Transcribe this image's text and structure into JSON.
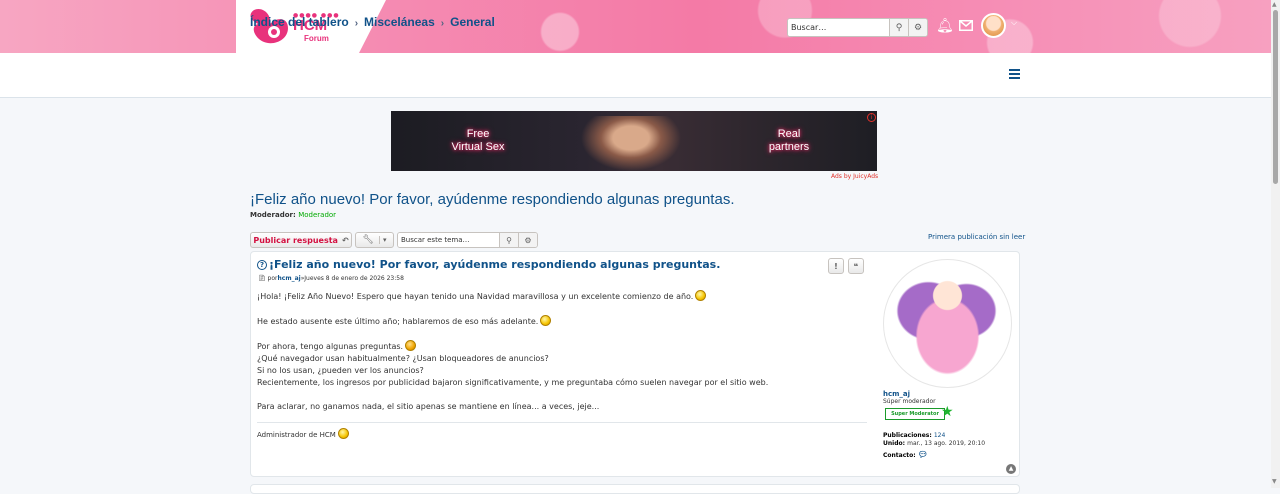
{
  "header": {
    "logo_text": "HCM",
    "logo_sub": "Forum",
    "search_placeholder": "Buscar…",
    "icons": [
      "search-icon",
      "gear-icon",
      "bell-icon",
      "envelope-icon",
      "avatar",
      "chevron-down-icon"
    ],
    "accent_color": "#f47aa6"
  },
  "breadcrumb": {
    "items": [
      "Índice del tablero",
      "Misceláneas",
      "General"
    ]
  },
  "ad": {
    "left_text_1": "Free",
    "left_text_2": "Virtual Sex",
    "right_text_1": "Real",
    "right_text_2": "partners",
    "by_text": "Ads by JuicyAds"
  },
  "topic": {
    "title": "¡Feliz año nuevo! Por favor, ayúdenme respondiendo algunas preguntas.",
    "moderator_label": "Moderador:",
    "moderator_name": "Moderador"
  },
  "actions": {
    "reply_label": "Publicar respuesta",
    "search_placeholder": "Buscar este tema…",
    "first_unread": "Primera publicación sin leer"
  },
  "post": {
    "title": "¡Feliz año nuevo! Por favor, ayúdenme respondiendo algunas preguntas.",
    "meta_prefix": "por",
    "author": "hcm_aj",
    "meta_sep": "»",
    "date": "Jueves 8 de enero de 2026 23:58",
    "lines": {
      "l1": "¡Hola! ¡Feliz Año Nuevo! Espero que hayan tenido una Navidad maravillosa y un excelente comienzo de año.",
      "l2": "He estado ausente este último año; hablaremos de eso más adelante.",
      "l3": "Por ahora, tengo algunas preguntas.",
      "l4": "¿Qué navegador usan habitualmente? ¿Usan bloqueadores de anuncios?",
      "l5": "Si no los usan, ¿pueden ver los anuncios?",
      "l6": "Recientemente, los ingresos por publicidad bajaron significativamente, y me preguntaba cómo suelen navegar por el sitio web.",
      "l7": "Para aclarar, no ganamos nada, el sitio apenas se mantiene en línea... a veces, jeje..."
    },
    "signature": "Administrador de HCM"
  },
  "profile": {
    "username": "hcm_aj",
    "rank": "Súper moderador",
    "badge": "Super Moderator",
    "posts_label": "Publicaciones:",
    "posts_value": "124",
    "joined_label": "Unido:",
    "joined_value": "mar., 13 ago. 2019, 20:10",
    "contact_label": "Contacto:"
  }
}
